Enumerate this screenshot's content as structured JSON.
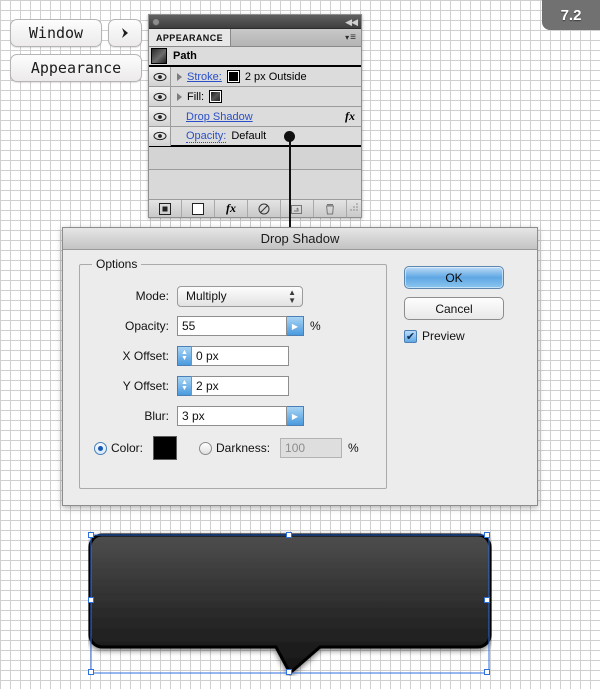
{
  "version_badge": {
    "label": "7.2"
  },
  "menu_path": {
    "window_label": "Window",
    "arrow_icon": "chevron-right-icon",
    "appearance_label": "Appearance"
  },
  "appearance_panel": {
    "tab_label": "APPEARANCE",
    "close_icon": "close-icon",
    "collapse_icon": "collapse-arrows-icon",
    "menu_icon": "panel-menu-icon",
    "target_label": "Path",
    "rows": [
      {
        "label": "Stroke:",
        "value": "2 px  Outside",
        "underline": "solid",
        "has_swatch": true,
        "has_disclosure": true,
        "eye": "eye-icon"
      },
      {
        "label": "Fill:",
        "value": "",
        "underline": "none",
        "has_swatch": true,
        "has_disclosure": true,
        "eye": "eye-icon"
      },
      {
        "label": "Drop Shadow",
        "value": "",
        "underline": "solid",
        "has_swatch": false,
        "has_disclosure": false,
        "eye": "eye-icon",
        "fx": "fx"
      },
      {
        "label": "Opacity:",
        "value": "Default",
        "underline": "dotted",
        "has_swatch": false,
        "has_disclosure": false,
        "eye": "eye-icon"
      }
    ],
    "toolbar_icons": [
      "new-art-has-basic-appearance-icon",
      "clear-appearance-icon",
      "add-new-effect-icon",
      "duplicate-selected-item-icon",
      "delete-selected-item-icon"
    ],
    "resize_icon": "resize-grip-icon"
  },
  "dialog": {
    "title": "Drop Shadow",
    "options_legend": "Options",
    "fields": {
      "mode_label": "Mode:",
      "mode_value": "Multiply",
      "opacity_label": "Opacity:",
      "opacity_value": "55",
      "opacity_unit": "%",
      "x_offset_label": "X Offset:",
      "x_offset_value": "0 px",
      "y_offset_label": "Y Offset:",
      "y_offset_value": "2 px",
      "blur_label": "Blur:",
      "blur_value": "3 px",
      "color_label": "Color:",
      "darkness_label": "Darkness:",
      "darkness_value": "100",
      "darkness_unit": "%"
    },
    "buttons": {
      "ok_label": "OK",
      "cancel_label": "Cancel",
      "preview_label": "Preview"
    },
    "colors": {
      "shadow_color": "#000000",
      "accent_blue": "#4a9ade",
      "link_blue": "#2b4fc8"
    }
  },
  "artwork": {
    "name": "speech-bubble-shape",
    "fill_top": "#4a4a4a",
    "fill_bottom": "#151515"
  }
}
